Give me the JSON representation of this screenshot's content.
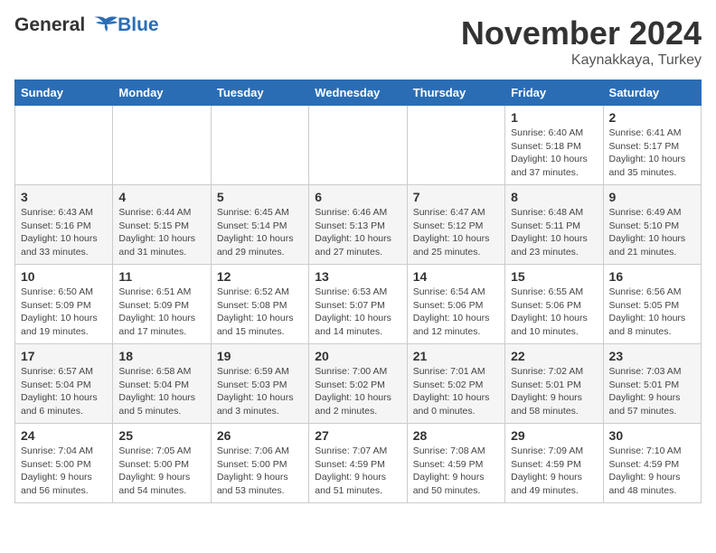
{
  "header": {
    "logo_line1": "General",
    "logo_line2": "Blue",
    "month_title": "November 2024",
    "location": "Kaynakkaya, Turkey"
  },
  "days_of_week": [
    "Sunday",
    "Monday",
    "Tuesday",
    "Wednesday",
    "Thursday",
    "Friday",
    "Saturday"
  ],
  "weeks": [
    [
      {
        "day": "",
        "info": ""
      },
      {
        "day": "",
        "info": ""
      },
      {
        "day": "",
        "info": ""
      },
      {
        "day": "",
        "info": ""
      },
      {
        "day": "",
        "info": ""
      },
      {
        "day": "1",
        "info": "Sunrise: 6:40 AM\nSunset: 5:18 PM\nDaylight: 10 hours\nand 37 minutes."
      },
      {
        "day": "2",
        "info": "Sunrise: 6:41 AM\nSunset: 5:17 PM\nDaylight: 10 hours\nand 35 minutes."
      }
    ],
    [
      {
        "day": "3",
        "info": "Sunrise: 6:43 AM\nSunset: 5:16 PM\nDaylight: 10 hours\nand 33 minutes."
      },
      {
        "day": "4",
        "info": "Sunrise: 6:44 AM\nSunset: 5:15 PM\nDaylight: 10 hours\nand 31 minutes."
      },
      {
        "day": "5",
        "info": "Sunrise: 6:45 AM\nSunset: 5:14 PM\nDaylight: 10 hours\nand 29 minutes."
      },
      {
        "day": "6",
        "info": "Sunrise: 6:46 AM\nSunset: 5:13 PM\nDaylight: 10 hours\nand 27 minutes."
      },
      {
        "day": "7",
        "info": "Sunrise: 6:47 AM\nSunset: 5:12 PM\nDaylight: 10 hours\nand 25 minutes."
      },
      {
        "day": "8",
        "info": "Sunrise: 6:48 AM\nSunset: 5:11 PM\nDaylight: 10 hours\nand 23 minutes."
      },
      {
        "day": "9",
        "info": "Sunrise: 6:49 AM\nSunset: 5:10 PM\nDaylight: 10 hours\nand 21 minutes."
      }
    ],
    [
      {
        "day": "10",
        "info": "Sunrise: 6:50 AM\nSunset: 5:09 PM\nDaylight: 10 hours\nand 19 minutes."
      },
      {
        "day": "11",
        "info": "Sunrise: 6:51 AM\nSunset: 5:09 PM\nDaylight: 10 hours\nand 17 minutes."
      },
      {
        "day": "12",
        "info": "Sunrise: 6:52 AM\nSunset: 5:08 PM\nDaylight: 10 hours\nand 15 minutes."
      },
      {
        "day": "13",
        "info": "Sunrise: 6:53 AM\nSunset: 5:07 PM\nDaylight: 10 hours\nand 14 minutes."
      },
      {
        "day": "14",
        "info": "Sunrise: 6:54 AM\nSunset: 5:06 PM\nDaylight: 10 hours\nand 12 minutes."
      },
      {
        "day": "15",
        "info": "Sunrise: 6:55 AM\nSunset: 5:06 PM\nDaylight: 10 hours\nand 10 minutes."
      },
      {
        "day": "16",
        "info": "Sunrise: 6:56 AM\nSunset: 5:05 PM\nDaylight: 10 hours\nand 8 minutes."
      }
    ],
    [
      {
        "day": "17",
        "info": "Sunrise: 6:57 AM\nSunset: 5:04 PM\nDaylight: 10 hours\nand 6 minutes."
      },
      {
        "day": "18",
        "info": "Sunrise: 6:58 AM\nSunset: 5:04 PM\nDaylight: 10 hours\nand 5 minutes."
      },
      {
        "day": "19",
        "info": "Sunrise: 6:59 AM\nSunset: 5:03 PM\nDaylight: 10 hours\nand 3 minutes."
      },
      {
        "day": "20",
        "info": "Sunrise: 7:00 AM\nSunset: 5:02 PM\nDaylight: 10 hours\nand 2 minutes."
      },
      {
        "day": "21",
        "info": "Sunrise: 7:01 AM\nSunset: 5:02 PM\nDaylight: 10 hours\nand 0 minutes."
      },
      {
        "day": "22",
        "info": "Sunrise: 7:02 AM\nSunset: 5:01 PM\nDaylight: 9 hours\nand 58 minutes."
      },
      {
        "day": "23",
        "info": "Sunrise: 7:03 AM\nSunset: 5:01 PM\nDaylight: 9 hours\nand 57 minutes."
      }
    ],
    [
      {
        "day": "24",
        "info": "Sunrise: 7:04 AM\nSunset: 5:00 PM\nDaylight: 9 hours\nand 56 minutes."
      },
      {
        "day": "25",
        "info": "Sunrise: 7:05 AM\nSunset: 5:00 PM\nDaylight: 9 hours\nand 54 minutes."
      },
      {
        "day": "26",
        "info": "Sunrise: 7:06 AM\nSunset: 5:00 PM\nDaylight: 9 hours\nand 53 minutes."
      },
      {
        "day": "27",
        "info": "Sunrise: 7:07 AM\nSunset: 4:59 PM\nDaylight: 9 hours\nand 51 minutes."
      },
      {
        "day": "28",
        "info": "Sunrise: 7:08 AM\nSunset: 4:59 PM\nDaylight: 9 hours\nand 50 minutes."
      },
      {
        "day": "29",
        "info": "Sunrise: 7:09 AM\nSunset: 4:59 PM\nDaylight: 9 hours\nand 49 minutes."
      },
      {
        "day": "30",
        "info": "Sunrise: 7:10 AM\nSunset: 4:59 PM\nDaylight: 9 hours\nand 48 minutes."
      }
    ]
  ]
}
